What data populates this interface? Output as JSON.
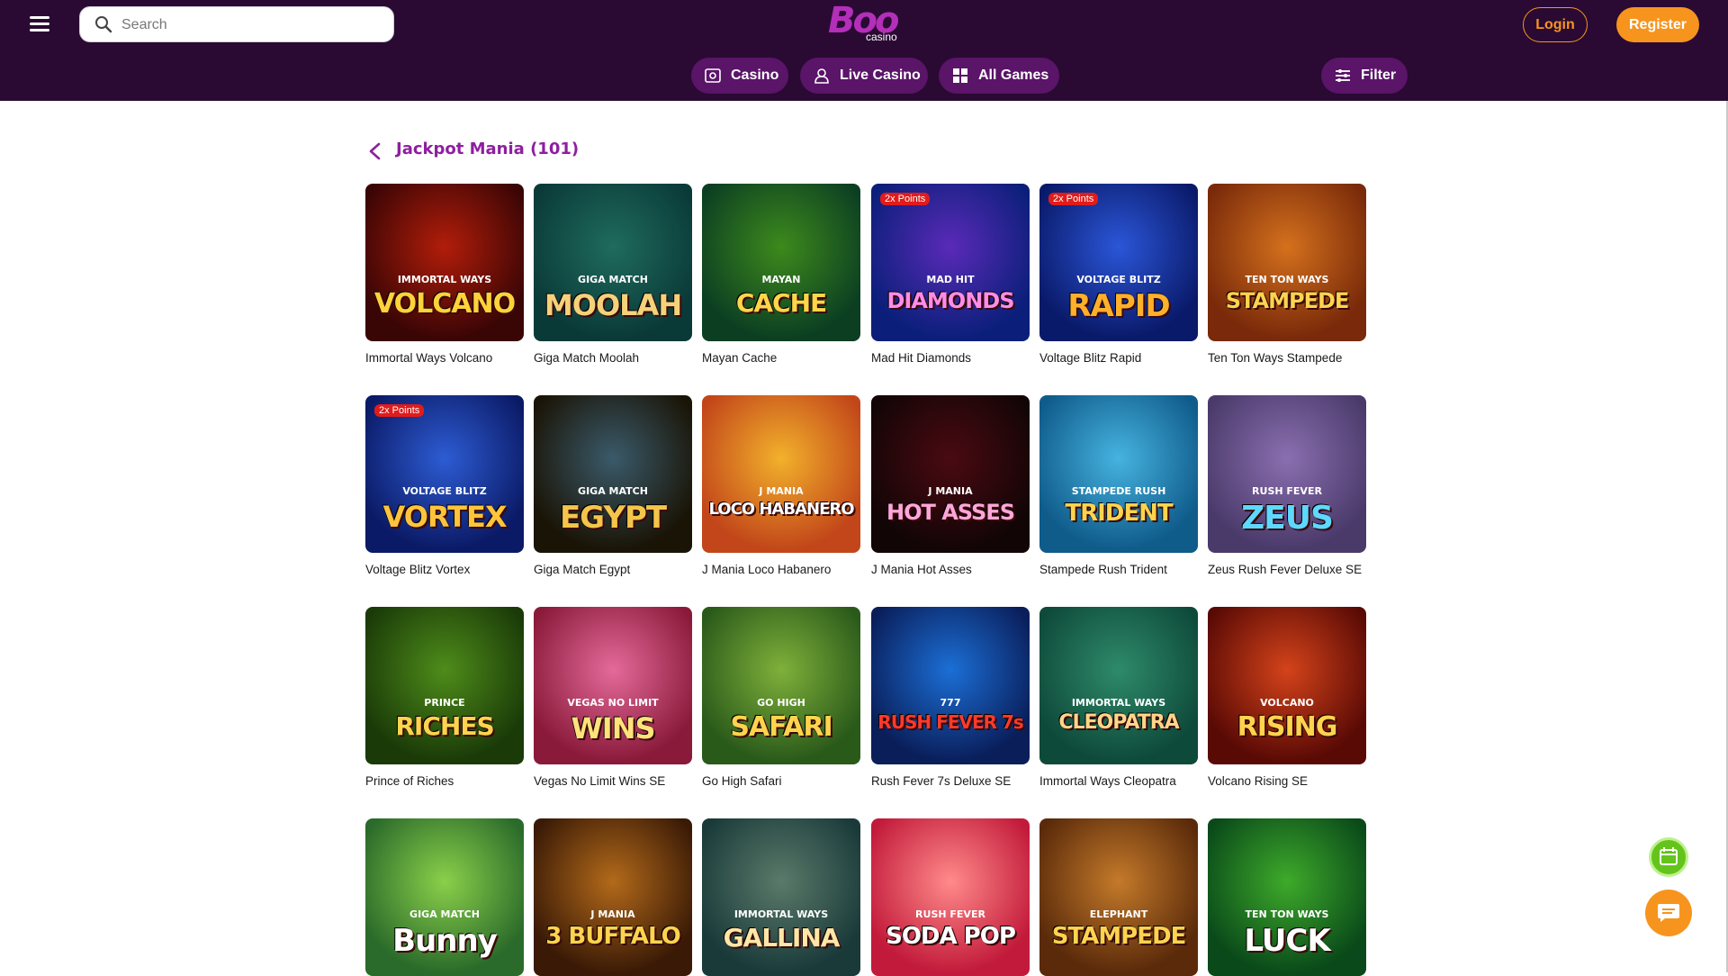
{
  "header": {
    "search_placeholder": "Search",
    "logo_text": "Boo",
    "logo_sub": "casino",
    "login_label": "Login",
    "register_label": "Register",
    "nav": [
      {
        "label": "Casino",
        "icon": "casino-icon"
      },
      {
        "label": "Live Casino",
        "icon": "live-dealer-icon"
      },
      {
        "label": "All Games",
        "icon": "grid-icon"
      }
    ],
    "filter_label": "Filter"
  },
  "page": {
    "title": "Jackpot Mania (101)"
  },
  "games": [
    {
      "name": "Immortal Ways Volcano",
      "art_top": "IMMORTAL WAYS",
      "art_main": "VOLCANO",
      "badge": ""
    },
    {
      "name": "Giga Match Moolah",
      "art_top": "GIGA MATCH",
      "art_main": "MOOLAH",
      "badge": ""
    },
    {
      "name": "Mayan Cache",
      "art_top": "MAYAN",
      "art_main": "CACHE",
      "badge": ""
    },
    {
      "name": "Mad Hit Diamonds",
      "art_top": "MAD HIT",
      "art_main": "DIAMONDS",
      "badge": "2x Points"
    },
    {
      "name": "Voltage Blitz Rapid",
      "art_top": "VOLTAGE BLITZ",
      "art_main": "RAPID",
      "badge": "2x Points"
    },
    {
      "name": "Ten Ton Ways Stampede",
      "art_top": "TEN TON WAYS",
      "art_main": "STAMPEDE",
      "badge": ""
    },
    {
      "name": "Voltage Blitz Vortex",
      "art_top": "VOLTAGE BLITZ",
      "art_main": "VORTEX",
      "badge": "2x Points"
    },
    {
      "name": "Giga Match Egypt",
      "art_top": "GIGA MATCH",
      "art_main": "EGYPT",
      "badge": ""
    },
    {
      "name": "J Mania Loco Habanero",
      "art_top": "J MANIA",
      "art_main": "LOCO HABANERO",
      "badge": ""
    },
    {
      "name": "J Mania Hot Asses",
      "art_top": "J MANIA",
      "art_main": "HOT ASSES",
      "badge": ""
    },
    {
      "name": "Stampede Rush Trident",
      "art_top": "STAMPEDE RUSH",
      "art_main": "TRIDENT",
      "badge": ""
    },
    {
      "name": "Zeus Rush Fever Deluxe SE",
      "art_top": "RUSH FEVER",
      "art_main": "ZEUS",
      "badge": ""
    },
    {
      "name": "Prince of Riches",
      "art_top": "PRINCE",
      "art_main": "RICHES",
      "badge": ""
    },
    {
      "name": "Vegas No Limit Wins SE",
      "art_top": "VEGAS NO LIMIT",
      "art_main": "WINS",
      "badge": ""
    },
    {
      "name": "Go High Safari",
      "art_top": "GO HIGH",
      "art_main": "SAFARI",
      "badge": ""
    },
    {
      "name": "Rush Fever 7s Deluxe SE",
      "art_top": "777",
      "art_main": "RUSH FEVER 7s",
      "badge": ""
    },
    {
      "name": "Immortal Ways Cleopatra",
      "art_top": "IMMORTAL WAYS",
      "art_main": "CLEOPATRA",
      "badge": ""
    },
    {
      "name": "Volcano Rising SE",
      "art_top": "VOLCANO",
      "art_main": "RISING",
      "badge": ""
    },
    {
      "name": "",
      "art_top": "GIGA MATCH",
      "art_main": "Bunny",
      "badge": ""
    },
    {
      "name": "",
      "art_top": "J MANIA",
      "art_main": "3 BUFFALO",
      "badge": ""
    },
    {
      "name": "",
      "art_top": "IMMORTAL WAYS",
      "art_main": "GALLINA",
      "badge": ""
    },
    {
      "name": "",
      "art_top": "RUSH FEVER",
      "art_main": "SODA POP",
      "badge": ""
    },
    {
      "name": "",
      "art_top": "ELEPHANT",
      "art_main": "STAMPEDE",
      "badge": ""
    },
    {
      "name": "",
      "art_top": "TEN TON WAYS",
      "art_main": "LUCK",
      "badge": ""
    }
  ],
  "colors": {
    "header_bg": "#2a0a33",
    "accent": "#f7941d",
    "title": "#8e1fa0",
    "pill_bg": "#5a1468"
  }
}
